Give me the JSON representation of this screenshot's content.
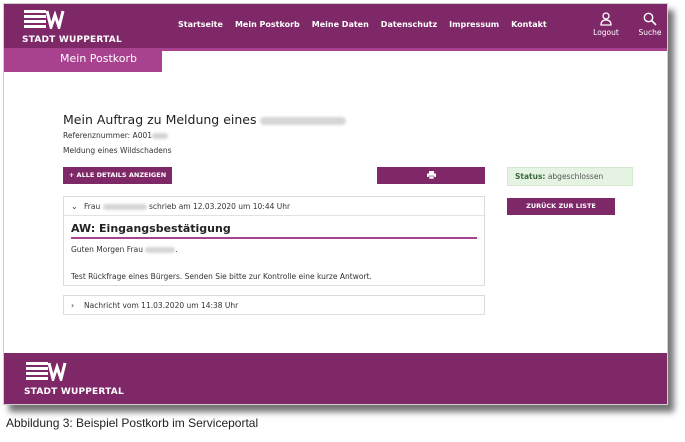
{
  "header": {
    "brand": "STADT WUPPERTAL",
    "nav": [
      "Startseite",
      "Mein Postkorb",
      "Meine Daten",
      "Datenschutz",
      "Impressum",
      "Kontakt"
    ],
    "logout_label": "Logout",
    "search_label": "Suche"
  },
  "page_tab": "Mein Postkorb",
  "request": {
    "title": "Mein Auftrag zu Meldung eines",
    "reference": "Referenznummer: A001",
    "subject": "Meldung eines Wildschadens"
  },
  "buttons": {
    "details": "+ ALLE DETAILS ANZEIGEN",
    "back": "ZURÜCK ZUR LISTE"
  },
  "status": {
    "label": "Status:",
    "value": "abgeschlossen"
  },
  "message1": {
    "sender_prefix": "Frau",
    "meta": "schrieb am 12.03.2020 um 10:44 Uhr",
    "title": "AW: Eingangsbestätigung",
    "greeting": "Guten Morgen Frau",
    "body": "Test Rückfrage eines Bürgers. Senden Sie bitte zur Kontrolle eine kurze Antwort."
  },
  "message2": {
    "meta": "Nachricht vom 11.03.2020 um 14:38 Uhr"
  },
  "footer": {
    "brand": "STADT WUPPERTAL"
  },
  "caption": "Abbildung 3: Beispiel Postkorb im Serviceportal",
  "colors": {
    "brand": "#7e2868",
    "accent": "#a8418e",
    "status_bg": "#e5f3e3"
  }
}
